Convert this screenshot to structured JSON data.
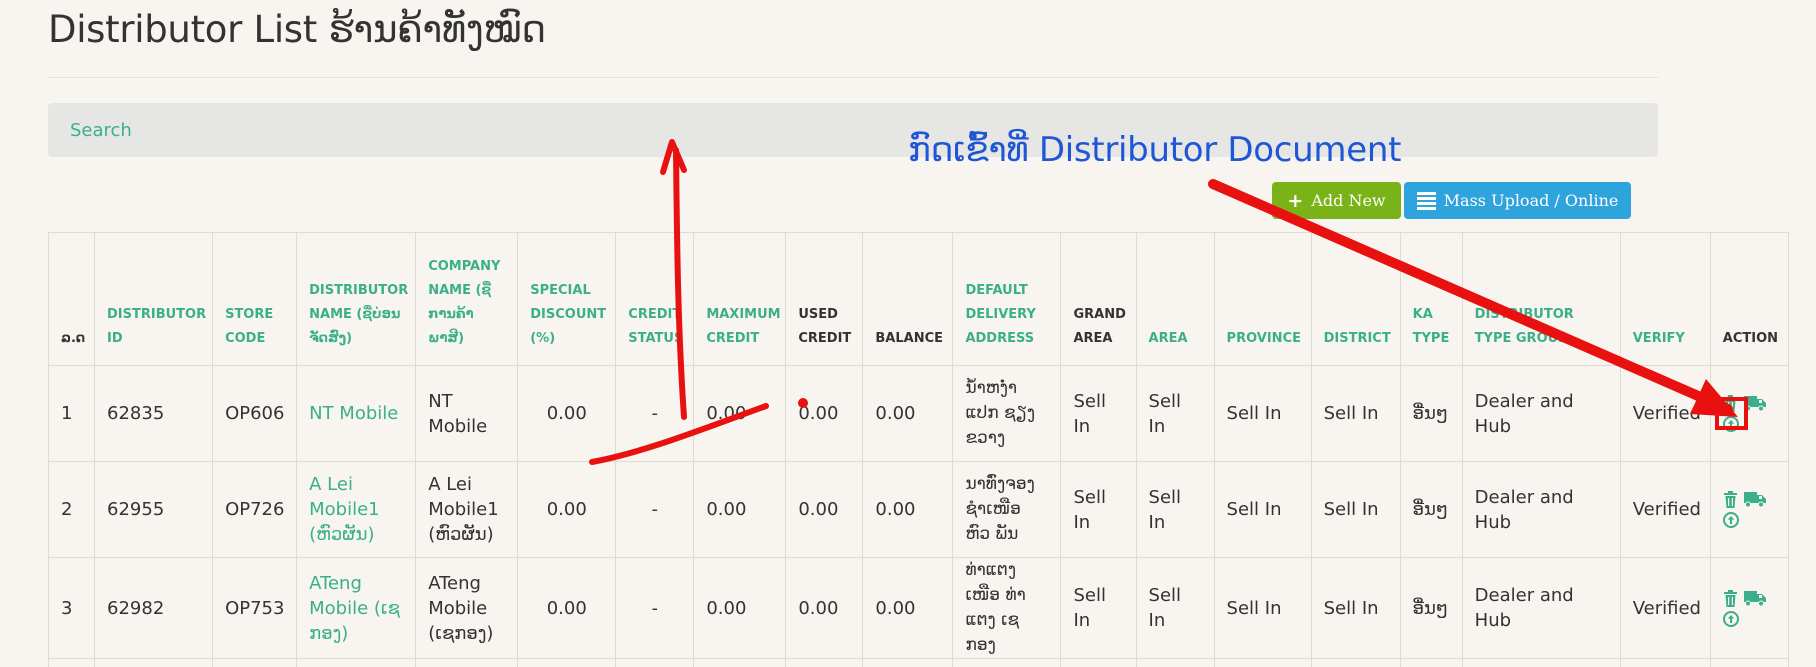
{
  "page": {
    "title": "Distributor List ຮ້ານຄ້າທັງໝົດ"
  },
  "search": {
    "placeholder": "Search"
  },
  "toolbar": {
    "add_label": "Add New",
    "mass_label": "Mass Upload / Online"
  },
  "table": {
    "headers": [
      "ລ.ດ",
      "DISTRIBUTOR ID",
      "STORE CODE",
      "DISTRIBUTOR NAME (ຊື່ບ່ອນຈັດສົ່ງ)",
      "COMPANY NAME (ຊື່ການຄ້າ ພາສີ)",
      "SPECIAL DISCOUNT (%)",
      "CREDIT STATUS",
      "MAXIMUM CREDIT",
      "USED CREDIT",
      "BALANCE",
      "DEFAULT DELIVERY ADDRESS",
      "GRAND AREA",
      "AREA",
      "PROVINCE",
      "DISTRICT",
      "KA TYPE",
      "DISTRIBUTOR TYPE GROUP",
      "VERIFY",
      "ACTION"
    ],
    "rows": [
      [
        "1",
        "62835",
        "OP606",
        "NT Mobile",
        "NT Mobile",
        "0.00",
        "-",
        "0.00",
        "0.00",
        "0.00",
        "ນ້ຳຫງ່ຳ ແປກ ຊຽງ ຂວາງ",
        "Sell In",
        "Sell In",
        "Sell In",
        "Sell In",
        "ອື່ນໆ",
        "Dealer and Hub",
        "Verified"
      ],
      [
        "2",
        "62955",
        "OP726",
        "A Lei Mobile1 (ຫົວຜັນ)",
        "A Lei Mobile1 (ຫົວຜັນ)",
        "0.00",
        "-",
        "0.00",
        "0.00",
        "0.00",
        "ນາທົ່ງຈອງ ຊໍາເໜືອ ຫົວ ພັນ",
        "Sell In",
        "Sell In",
        "Sell In",
        "Sell In",
        "ອື່ນໆ",
        "Dealer and Hub",
        "Verified"
      ],
      [
        "3",
        "62982",
        "OP753",
        "ATeng Mobile (ເຊ ກອງ)",
        "ATeng Mobile (ເຊກອງ)",
        "0.00",
        "-",
        "0.00",
        "0.00",
        "0.00",
        "ທ່າແຕງເໜືອ ທ່າແຕງ ເຊ ກອງ",
        "Sell In",
        "Sell In",
        "Sell In",
        "Sell In",
        "ອື່ນໆ",
        "Dealer and Hub",
        "Verified"
      ]
    ]
  },
  "annotation": {
    "text": "ກົດເຂົ້າທີ່ Distributor Document"
  },
  "icons": {
    "add": "plus-icon",
    "mass": "list-icon",
    "delete": "trash-icon",
    "truck": "truck-icon",
    "upload": "upload-circle-icon"
  },
  "colors": {
    "accent": "#3aaf8a",
    "add_button": "#7ab317",
    "mass_button": "#2fa3dc",
    "annotation_arrow": "#e8110f",
    "annotation_text": "#1f56d6"
  }
}
